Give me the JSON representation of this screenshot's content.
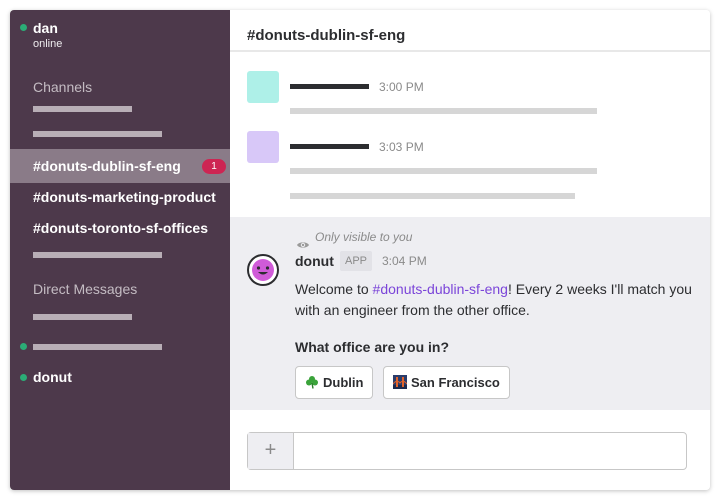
{
  "user": {
    "name": "dan",
    "status": "online"
  },
  "sidebar": {
    "channels_title": "Channels",
    "channels": [
      {
        "label": "#donuts-dublin-sf-eng",
        "badge": "1",
        "active": true
      },
      {
        "label": "#donuts-marketing-product"
      },
      {
        "label": "#donuts-toronto-sf-offices"
      }
    ],
    "dm_title": "Direct Messages",
    "dm_items": [
      {
        "label": "donut"
      }
    ]
  },
  "channel": {
    "title": "#donuts-dublin-sf-eng"
  },
  "messages": [
    {
      "time": "3:00 PM",
      "avatar_color": "#aef0e8"
    },
    {
      "time": "3:03 PM",
      "avatar_color": "#d8c8f8"
    }
  ],
  "bot_message": {
    "visibility_note": "Only visible to you",
    "sender": "donut",
    "tag": "APP",
    "time": "3:04 PM",
    "text_before": "Welcome to ",
    "channel_link": "#donuts-dublin-sf-eng",
    "text_after": "! Every 2 weeks I'll match you with an engineer from the other office.",
    "question": "What office are you in?",
    "buttons": [
      {
        "label": "Dublin",
        "icon": "shamrock-icon"
      },
      {
        "label": "San Francisco",
        "icon": "golden-gate-icon"
      }
    ]
  },
  "composer": {
    "add_label": "+"
  },
  "colors": {
    "sidebar": "#4d394b",
    "active_channel": "#8a7b88",
    "presence": "#2bac76",
    "badge": "#cd2553",
    "link": "#7b45d9",
    "bot_background": "#eeeef2"
  }
}
